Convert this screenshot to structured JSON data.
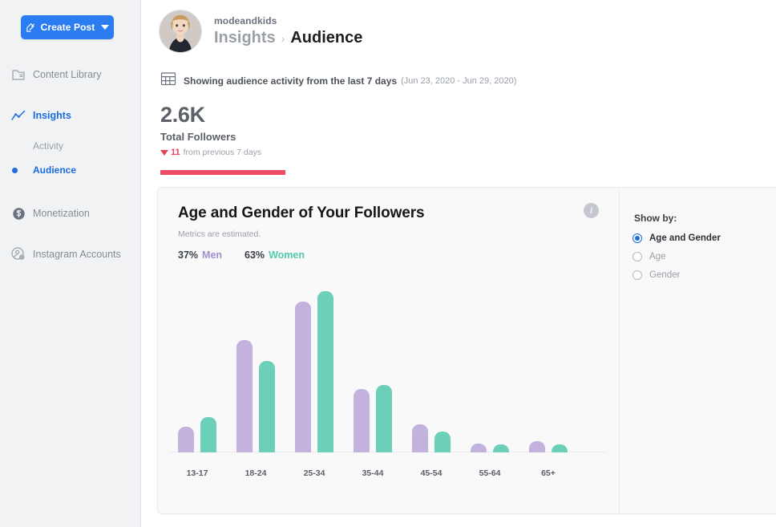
{
  "sidebar": {
    "create_post": {
      "label": "Create Post",
      "icon": "pencil-square-icon",
      "caret": "chevron-down-icon"
    },
    "items": [
      {
        "label": "Content Library",
        "icon": "content-library-icon",
        "active": false
      },
      {
        "label": "Insights",
        "icon": "insights-chart-icon",
        "active": true
      },
      {
        "label": "Monetization",
        "icon": "dollar-circle-icon",
        "active": false
      },
      {
        "label": "Instagram Accounts",
        "icon": "account-gear-icon",
        "active": false
      }
    ],
    "sub_items": [
      {
        "label": "Activity",
        "active": false
      },
      {
        "label": "Audience",
        "active": true
      }
    ]
  },
  "header": {
    "handle": "modeandkids",
    "breadcrumb_parent": "Insights",
    "breadcrumb_separator": "›",
    "breadcrumb_current": "Audience",
    "avatar_alt": "profile-photo"
  },
  "date_bar": {
    "icon": "calendar-icon",
    "text": "Showing audience activity from the last 7 days",
    "range": "(Jun 23, 2020 - Jun 29, 2020)"
  },
  "stat": {
    "value": "2.6K",
    "label": "Total Followers",
    "delta_direction": "down",
    "delta_value": "11",
    "delta_text": "from previous 7 days",
    "accent_color": "#ec4c64"
  },
  "card": {
    "title": "Age and Gender of Your Followers",
    "subtitle": "Metrics are estimated.",
    "info_icon": "info-icon",
    "info_glyph": "i",
    "legend": [
      {
        "pct": "37%",
        "name": "Men",
        "color": "#a08fd0"
      },
      {
        "pct": "63%",
        "name": "Women",
        "color": "#55c9ae"
      }
    ]
  },
  "show_by": {
    "title": "Show by:",
    "options": [
      {
        "label": "Age and Gender",
        "selected": true
      },
      {
        "label": "Age",
        "selected": false
      },
      {
        "label": "Gender",
        "selected": false
      }
    ]
  },
  "chart_data": {
    "type": "bar",
    "title": "Age and Gender of Your Followers",
    "subtitle": "Metrics are estimated.",
    "xlabel": "",
    "ylabel": "",
    "grid": false,
    "legend_position": "top-left",
    "categories": [
      "13-17",
      "18-24",
      "25-34",
      "35-44",
      "45-54",
      "55-64",
      "65+"
    ],
    "unit": "percent of followers",
    "ylim": [
      0,
      24
    ],
    "series": [
      {
        "name": "Men",
        "color": "#c3b2de",
        "values": [
          3.7,
          16.0,
          21.5,
          9.0,
          4.0,
          1.3,
          1.6
        ]
      },
      {
        "name": "Women",
        "color": "#6ccfb8",
        "values": [
          5.0,
          13.0,
          23.0,
          9.6,
          3.0,
          1.2,
          1.1
        ]
      }
    ],
    "totals": {
      "Men": "37%",
      "Women": "63%"
    }
  }
}
